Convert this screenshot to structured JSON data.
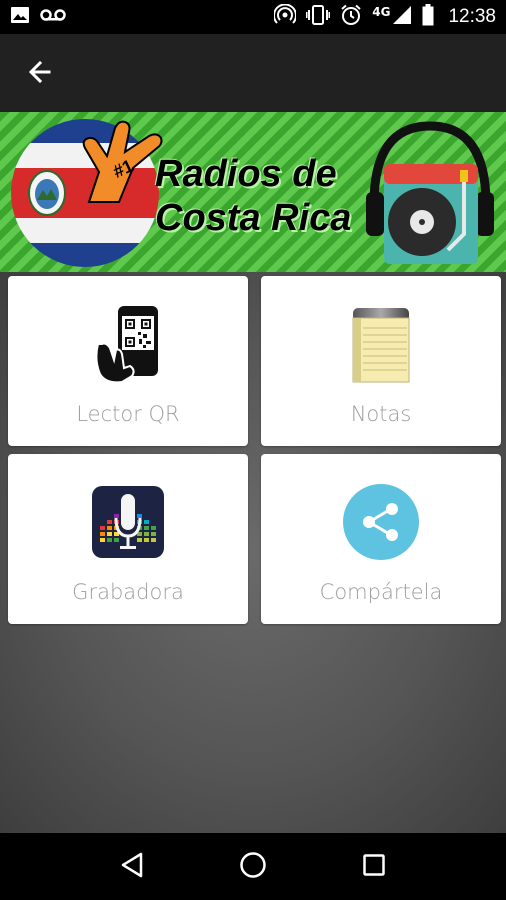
{
  "status_bar": {
    "time": "12:38",
    "network": "4G",
    "icons": [
      "image-icon",
      "voicemail-icon",
      "hotspot-icon",
      "vibrate-icon",
      "alarm-icon",
      "signal-icon",
      "battery-icon"
    ]
  },
  "app_bar": {
    "back_icon": "arrow-left-icon"
  },
  "banner": {
    "title_line1": "Radios de",
    "title_line2": "Costa Rica",
    "hand_text": "#1"
  },
  "menu": {
    "items": [
      {
        "label": "Lector QR",
        "icon": "qr-reader-icon"
      },
      {
        "label": "Notas",
        "icon": "notes-icon"
      },
      {
        "label": "Grabadora",
        "icon": "recorder-icon"
      },
      {
        "label": "Compártela",
        "icon": "share-icon"
      }
    ]
  },
  "nav_bar": {
    "icons": [
      "back-triangle-icon",
      "home-circle-icon",
      "recents-square-icon"
    ]
  },
  "colors": {
    "app_bar": "#212121",
    "banner_green": "#3aa62e",
    "card_label": "#9e9e9e",
    "share_accent": "#5ec3e0"
  }
}
